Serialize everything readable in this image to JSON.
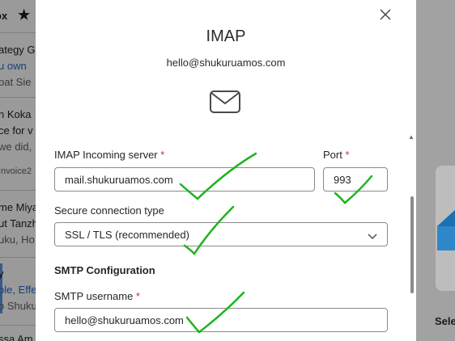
{
  "background_list": {
    "header_label": "ox",
    "rows": [
      {
        "lines": [
          "ategy Ga",
          "u own",
          "bat Sie"
        ]
      },
      {
        "lines": [
          "n Koka",
          "ce for v",
          "we did,",
          "Invoice2"
        ]
      },
      {
        "lines": [
          "me Miya",
          "ut Tanzh",
          "uku, Ho"
        ]
      },
      {
        "lines": [
          "y",
          "ole, Effe",
          "o Shuku"
        ]
      },
      {
        "lines": [
          "ssa Am"
        ]
      }
    ]
  },
  "background_right": {
    "label": "Sele"
  },
  "modal": {
    "title": "IMAP",
    "email": "hello@shukuruamos.com",
    "imap_server": {
      "label": "IMAP Incoming server",
      "required_mark": "*",
      "value": "mail.shukuruamos.com"
    },
    "port": {
      "label": "Port",
      "required_mark": "*",
      "value": "993"
    },
    "secure": {
      "label": "Secure connection type",
      "value": "SSL / TLS (recommended)"
    },
    "smtp_section": "SMTP Configuration",
    "smtp_username": {
      "label": "SMTP username",
      "required_mark": "*",
      "value": "hello@shukuruamos.com"
    }
  },
  "icons": [
    "close-icon",
    "mail-icon",
    "chevron-down-icon",
    "star-icon"
  ],
  "colors": {
    "required": "#c4314b",
    "checkmark": "#1db41d"
  }
}
